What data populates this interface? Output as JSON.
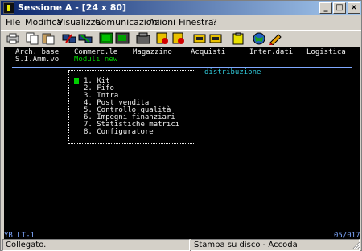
{
  "window": {
    "title": "Sessione A - [24 x 80]"
  },
  "title_buttons": {
    "minimize": "_",
    "maximize": "□",
    "close": "×"
  },
  "menu": {
    "file": "File",
    "modifica": "Modifica",
    "visualizza": "Visualizza",
    "comunicazioni": "Comunicazioni",
    "azioni": "Azioni",
    "finestra": "Finestra",
    "help": "?"
  },
  "toolbar": {
    "icons": [
      "print-icon",
      "copy-icon",
      "paste-icon",
      "send-icon",
      "receive-icon",
      "display-icon",
      "monitor-icon",
      "record-icon",
      "play-icon",
      "pause-icon",
      "macro-icon",
      "run-icon",
      "clipboard-icon",
      "globe-icon",
      "edit-icon"
    ]
  },
  "terminal": {
    "row1": [
      "Arch. base",
      "Commerc.le",
      "Magazzino",
      "Acquisti",
      "Inter.dati",
      "Logistica"
    ],
    "row2_left": "S.I.Amm.vo",
    "row2_right": "Moduli new",
    "section_title": "distribuzione",
    "menu_items": [
      "1. Kit",
      "2. Fifo",
      "3. Intra",
      "4. Post vendita",
      "5. Controllo qualità",
      "6. Impegni finanziari",
      "7. Statistiche matrici",
      "8. Configuratore"
    ],
    "oia_left": "YB LT-1",
    "oia_right": "05/017"
  },
  "status": {
    "left": "Collegato.",
    "right": "Stampa su disco - Accoda"
  }
}
